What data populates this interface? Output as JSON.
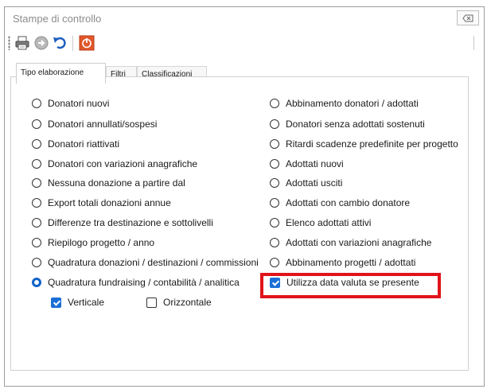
{
  "window": {
    "title": "Stampe di controllo",
    "close_glyph": "⌧"
  },
  "toolbar": {
    "buttons": [
      {
        "icon": "printer-icon"
      },
      {
        "icon": "forward-icon"
      },
      {
        "icon": "undo-icon"
      },
      {
        "icon": "exit-icon"
      }
    ]
  },
  "tabs": [
    {
      "label": "Tipo elaborazione",
      "active": true
    },
    {
      "label": "Filtri",
      "active": false
    },
    {
      "label": "Classificazioni",
      "active": false
    }
  ],
  "left_options": [
    {
      "label": "Donatori nuovi",
      "checked": false
    },
    {
      "label": "Donatori annullati/sospesi",
      "checked": false
    },
    {
      "label": "Donatori riattivati",
      "checked": false
    },
    {
      "label": "Donatori con variazioni anagrafiche",
      "checked": false
    },
    {
      "label": "Nessuna donazione a partire dal",
      "checked": false
    },
    {
      "label": "Export totali donazioni annue",
      "checked": false
    },
    {
      "label": "Differenze tra destinazione e sottolivelli",
      "checked": false
    },
    {
      "label": "Riepilogo progetto / anno",
      "checked": false
    },
    {
      "label": "Quadratura donazioni / destinazioni / commissioni",
      "checked": false
    },
    {
      "label": "Quadratura fundraising / contabilità / analitica",
      "checked": true
    }
  ],
  "right_options": [
    {
      "label": "Abbinamento donatori / adottati",
      "checked": false
    },
    {
      "label": "Donatori senza adottati sostenuti",
      "checked": false
    },
    {
      "label": "Ritardi scadenze predefinite per progetto",
      "checked": false
    },
    {
      "label": "Adottati nuovi",
      "checked": false
    },
    {
      "label": "Adottati usciti",
      "checked": false
    },
    {
      "label": "Adottati con cambio donatore",
      "checked": false
    },
    {
      "label": "Elenco adottati attivi",
      "checked": false
    },
    {
      "label": "Adottati con variazioni anagrafiche",
      "checked": false
    },
    {
      "label": "Abbinamento progetti / adottati",
      "checked": false
    }
  ],
  "sub_options": {
    "verticale": {
      "label": "Verticale",
      "checked": true
    },
    "orizzontale": {
      "label": "Orizzontale",
      "checked": false
    },
    "data_valuta": {
      "label": "Utilizza data valuta se presente",
      "checked": true
    }
  },
  "colors": {
    "accent": "#1a6fd6",
    "highlight": "#e0141a"
  }
}
